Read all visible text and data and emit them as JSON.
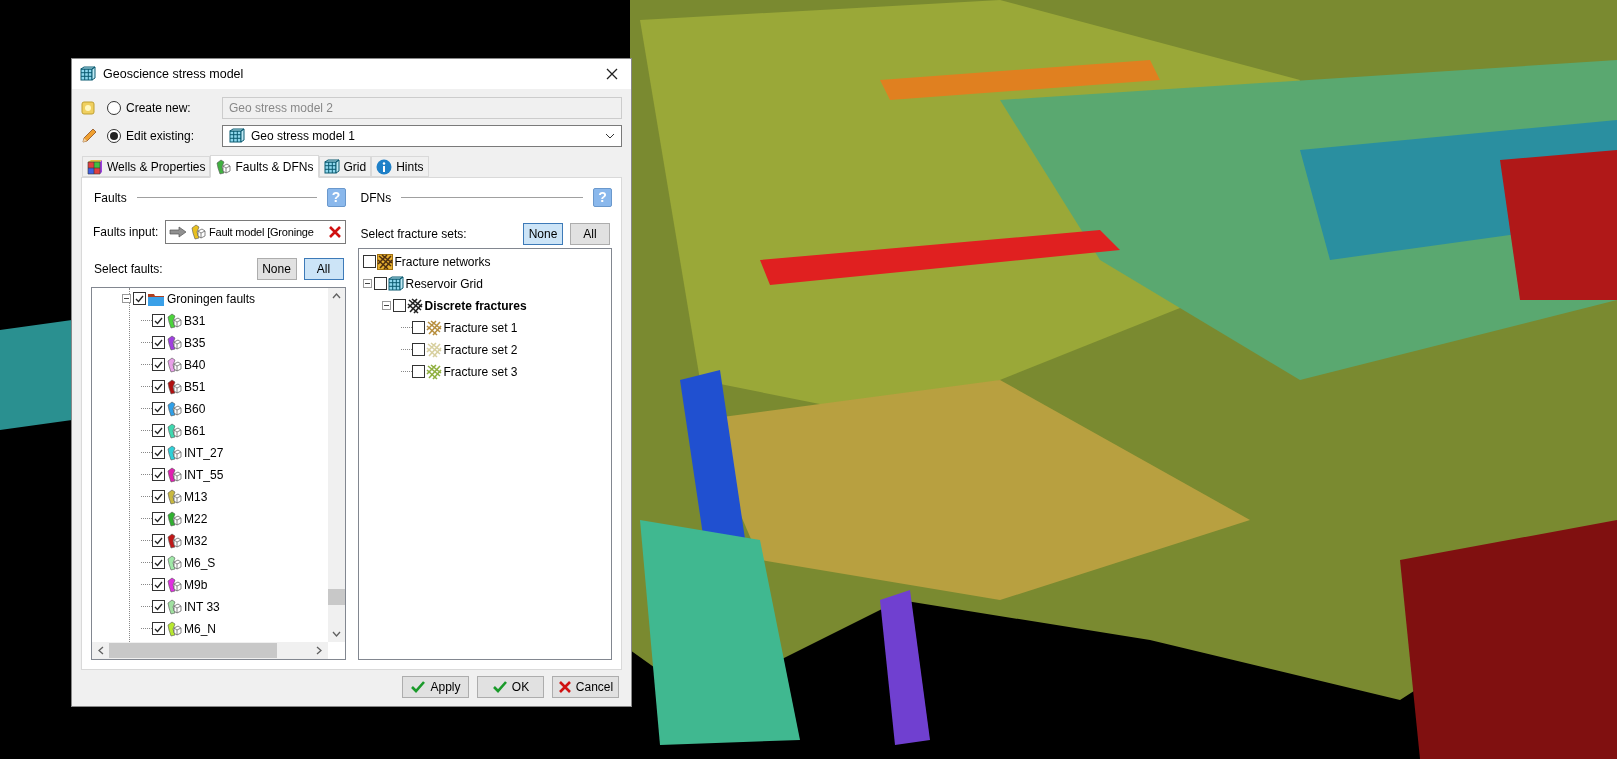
{
  "window": {
    "title": "Geoscience stress model"
  },
  "mode_options": [
    {
      "label": "Create new:",
      "selected": false,
      "kind": "new",
      "field": {
        "kind": "text",
        "value": "Geo stress model 2",
        "disabled": true
      }
    },
    {
      "label": "Edit existing:",
      "selected": true,
      "kind": "edit",
      "field": {
        "kind": "dropdown",
        "value": "Geo stress model 1",
        "disabled": false
      }
    }
  ],
  "tabs": [
    {
      "label": "Wells & Properties",
      "selected": false,
      "kind": "wells"
    },
    {
      "label": "Faults & DFNs",
      "selected": true,
      "kind": "faults"
    },
    {
      "label": "Grid",
      "selected": false,
      "kind": "grid"
    },
    {
      "label": "Hints",
      "selected": false,
      "kind": "info"
    }
  ],
  "faults": {
    "title": "Faults",
    "help": "?",
    "input_label": "Faults input:",
    "input_value": "Fault model [Groninge",
    "select_label": "Select faults:",
    "select_buttons": [
      {
        "label": "None",
        "selected": false
      },
      {
        "label": "All",
        "selected": true
      }
    ],
    "tree": [
      {
        "label": "Groningen faults",
        "kind": "folder",
        "checked": true,
        "expanded": true,
        "children": [
          {
            "label": "B31",
            "kind": "fault",
            "checked": true,
            "color": "#4cd43c"
          },
          {
            "label": "B35",
            "kind": "fault",
            "checked": true,
            "color": "#a040e0"
          },
          {
            "label": "B40",
            "kind": "fault",
            "checked": true,
            "color": "#e8a0e8"
          },
          {
            "label": "B51",
            "kind": "fault",
            "checked": true,
            "color": "#b01010"
          },
          {
            "label": "B60",
            "kind": "fault",
            "checked": true,
            "color": "#30a0e8"
          },
          {
            "label": "B61",
            "kind": "fault",
            "checked": true,
            "color": "#40d8b0"
          },
          {
            "label": "INT_27",
            "kind": "fault",
            "checked": true,
            "color": "#30d0d8"
          },
          {
            "label": "INT_55",
            "kind": "fault",
            "checked": true,
            "color": "#e020b0"
          },
          {
            "label": "M13",
            "kind": "fault",
            "checked": true,
            "color": "#c8b840"
          },
          {
            "label": "M22",
            "kind": "fault",
            "checked": true,
            "color": "#30b030"
          },
          {
            "label": "M32",
            "kind": "fault",
            "checked": true,
            "color": "#c01818"
          },
          {
            "label": "M6_S",
            "kind": "fault",
            "checked": true,
            "color": "#a0e8a8"
          },
          {
            "label": "M9b",
            "kind": "fault",
            "checked": true,
            "color": "#e030e0"
          },
          {
            "label": "INT 33",
            "kind": "fault",
            "checked": true,
            "color": "#a0e0a0"
          },
          {
            "label": "M6_N",
            "kind": "fault",
            "checked": true,
            "color": "#b8e830"
          }
        ]
      }
    ]
  },
  "dfns": {
    "title": "DFNs",
    "help": "?",
    "select_label": "Select fracture sets:",
    "select_buttons": [
      {
        "label": "None",
        "selected": true
      },
      {
        "label": "All",
        "selected": false
      }
    ],
    "tree": [
      {
        "label": "Fracture networks",
        "kind": "networks",
        "checked": false
      },
      {
        "label": "Reservoir Grid",
        "kind": "grid",
        "checked": false,
        "expanded": true,
        "children": [
          {
            "label": "Discrete fractures",
            "kind": "fractures",
            "checked": false,
            "expanded": true,
            "children": [
              {
                "label": "Fracture set 1",
                "kind": "fracture_set",
                "checked": false,
                "color": "#b89040"
              },
              {
                "label": "Fracture set 2",
                "kind": "fracture_set",
                "checked": false,
                "color": "#d8d0a0"
              },
              {
                "label": "Fracture set 3",
                "kind": "fracture_set",
                "checked": false,
                "color": "#90b040"
              }
            ]
          }
        ]
      }
    ]
  },
  "buttons": [
    {
      "label": "Apply",
      "kind": "confirm"
    },
    {
      "label": "OK",
      "kind": "confirm"
    },
    {
      "label": "Cancel",
      "kind": "cancel"
    }
  ]
}
